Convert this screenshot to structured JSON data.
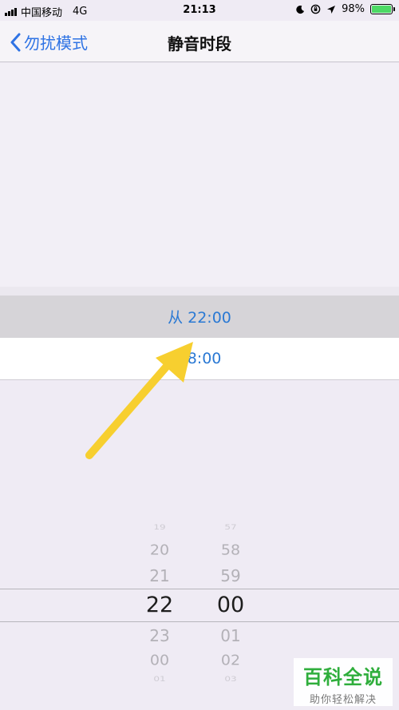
{
  "status_bar": {
    "carrier": "中国移动",
    "network": "4G",
    "time": "21:13",
    "battery_percent": "98%",
    "battery_level": 0.98,
    "icons": [
      "moon-icon",
      "orientation-lock-icon",
      "location-icon"
    ]
  },
  "nav": {
    "back_label": "勿扰模式",
    "title": "静音时段"
  },
  "schedule": {
    "from_label": "从 22:00",
    "to_label": "08:00"
  },
  "picker": {
    "hours": [
      "19",
      "20",
      "21",
      "22",
      "23",
      "00",
      "01"
    ],
    "minutes": [
      "57",
      "58",
      "59",
      "00",
      "01",
      "02",
      "03"
    ],
    "selected_hour": "22",
    "selected_minute": "00"
  },
  "watermark": {
    "title": "百科全说",
    "subtitle": "助你轻松解决"
  },
  "colors": {
    "accent": "#2a79d4",
    "arrow": "#f7cf2f",
    "watermark_green": "#2fae3c"
  }
}
